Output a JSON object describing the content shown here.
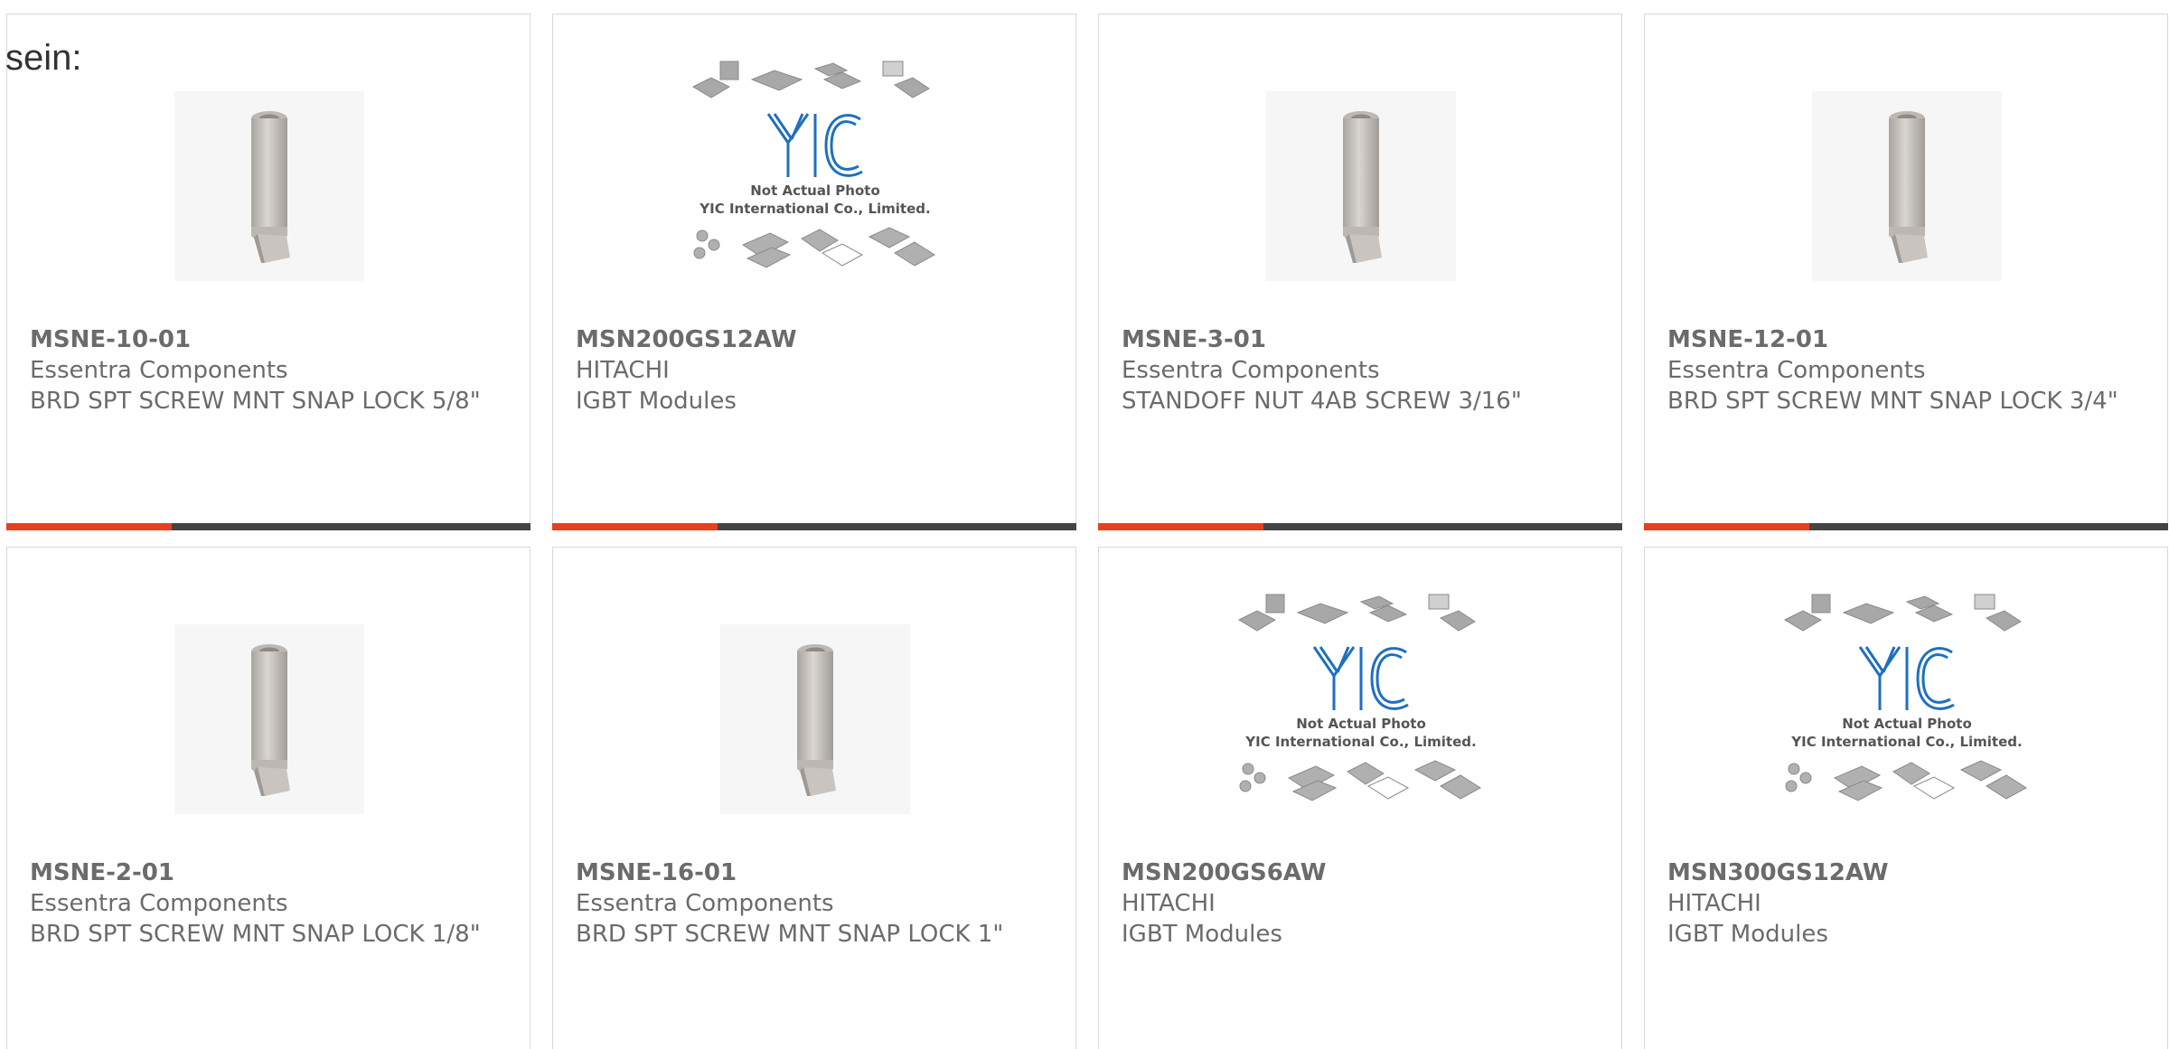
{
  "heading_fragment": "sein:",
  "colors": {
    "accent": "#e8401c",
    "bar": "#444444",
    "text": "#6b6b6b",
    "logo_blue": "#1e6fbf"
  },
  "products": [
    {
      "part_number": "MSNE-10-01",
      "manufacturer": "Essentra Components",
      "description": "BRD SPT SCREW MNT SNAP LOCK 5/8\"",
      "image": "standoff-photo"
    },
    {
      "part_number": "MSN200GS12AW",
      "manufacturer": "HITACHI",
      "description": "IGBT Modules",
      "image": "placeholder-yic",
      "placeholder_line1": "Not Actual Photo",
      "placeholder_line2": "YIC International Co., Limited."
    },
    {
      "part_number": "MSNE-3-01",
      "manufacturer": "Essentra Components",
      "description": "STANDOFF NUT 4AB SCREW 3/16\"",
      "image": "standoff-photo"
    },
    {
      "part_number": "MSNE-12-01",
      "manufacturer": "Essentra Components",
      "description": "BRD SPT SCREW MNT SNAP LOCK 3/4\"",
      "image": "standoff-photo"
    },
    {
      "part_number": "MSNE-2-01",
      "manufacturer": "Essentra Components",
      "description": "BRD SPT SCREW MNT SNAP LOCK 1/8\"",
      "image": "standoff-photo"
    },
    {
      "part_number": "MSNE-16-01",
      "manufacturer": "Essentra Components",
      "description": "BRD SPT SCREW MNT SNAP LOCK 1\"",
      "image": "standoff-photo"
    },
    {
      "part_number": "MSN200GS6AW",
      "manufacturer": "HITACHI",
      "description": "IGBT Modules",
      "image": "placeholder-yic",
      "placeholder_line1": "Not Actual Photo",
      "placeholder_line2": "YIC International Co., Limited."
    },
    {
      "part_number": "MSN300GS12AW",
      "manufacturer": "HITACHI",
      "description": "IGBT Modules",
      "image": "placeholder-yic",
      "placeholder_line1": "Not Actual Photo",
      "placeholder_line2": "YIC International Co., Limited."
    }
  ]
}
